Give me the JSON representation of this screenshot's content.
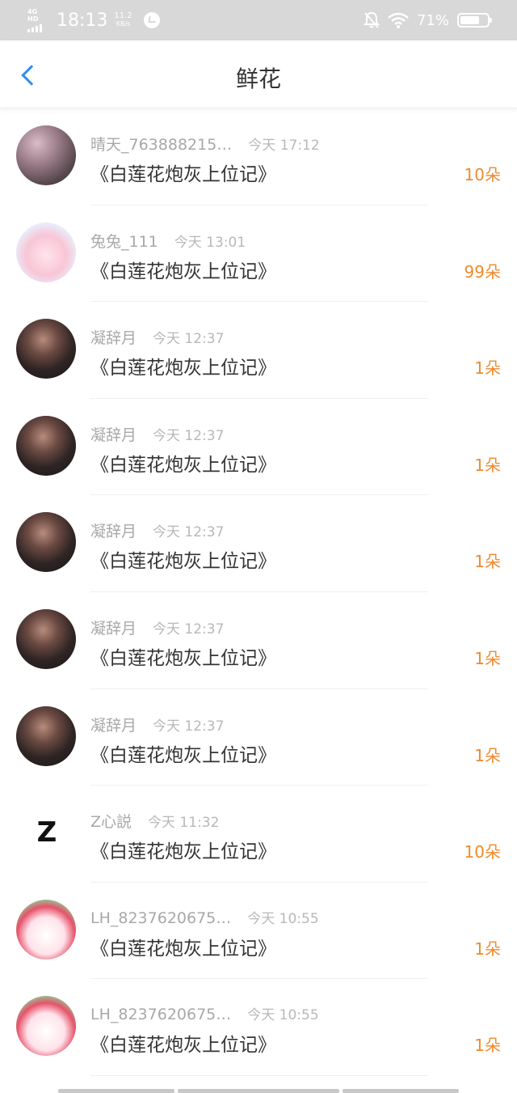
{
  "status_bar": {
    "network": "4G HD",
    "time": "18:13",
    "speed_value": "11.2",
    "speed_unit": "KB/s",
    "battery_percent": "71%",
    "battery_level": 0.71
  },
  "header": {
    "title": "鲜花"
  },
  "items": [
    {
      "name": "晴天_763888215…",
      "time": "今天 17:12",
      "book": "《白莲花炮灰上位记》",
      "count": "10朵",
      "avatar": "tree"
    },
    {
      "name": "兔兔_111",
      "time": "今天 13:01",
      "book": "《白莲花炮灰上位记》",
      "count": "99朵",
      "avatar": "bunny"
    },
    {
      "name": "凝辞月",
      "time": "今天 12:37",
      "book": "《白莲花炮灰上位记》",
      "count": "1朵",
      "avatar": "girl"
    },
    {
      "name": "凝辞月",
      "time": "今天 12:37",
      "book": "《白莲花炮灰上位记》",
      "count": "1朵",
      "avatar": "girl"
    },
    {
      "name": "凝辞月",
      "time": "今天 12:37",
      "book": "《白莲花炮灰上位记》",
      "count": "1朵",
      "avatar": "girl"
    },
    {
      "name": "凝辞月",
      "time": "今天 12:37",
      "book": "《白莲花炮灰上位记》",
      "count": "1朵",
      "avatar": "girl"
    },
    {
      "name": "凝辞月",
      "time": "今天 12:37",
      "book": "《白莲花炮灰上位记》",
      "count": "1朵",
      "avatar": "girl"
    },
    {
      "name": "Z心説",
      "time": "今天 11:32",
      "book": "《白莲花炮灰上位记》",
      "count": "10朵",
      "avatar": "z",
      "avatar_text": "Z"
    },
    {
      "name": "LH_8237620675…",
      "time": "今天 10:55",
      "book": "《白莲花炮灰上位记》",
      "count": "1朵",
      "avatar": "melody"
    },
    {
      "name": "LH_8237620675…",
      "time": "今天 10:55",
      "book": "《白莲花炮灰上位记》",
      "count": "1朵",
      "avatar": "melody"
    }
  ],
  "colors": {
    "accent_blue": "#2a8ff0",
    "count_orange": "#f08a2c",
    "status_bar_bg": "#d8d8d8"
  }
}
